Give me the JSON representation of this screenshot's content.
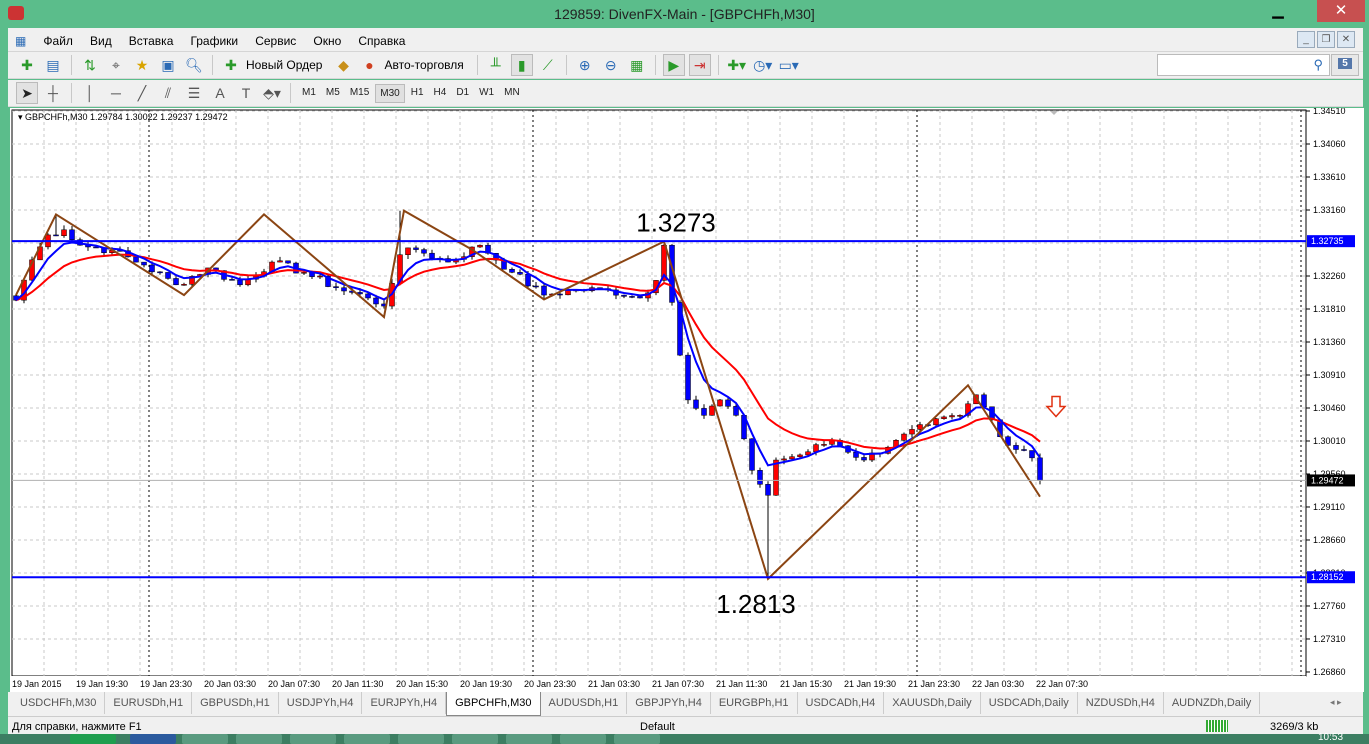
{
  "window": {
    "title": "129859: DivenFX-Main - [GBPCHFh,M30]",
    "min": "▁",
    "max": "☐",
    "close": "✕"
  },
  "menu": [
    "Файл",
    "Вид",
    "Вставка",
    "Графики",
    "Сервис",
    "Окно",
    "Справка"
  ],
  "toolbar": {
    "new_order": "Новый Ордер",
    "autotrading": "Авто-торговля",
    "timeframes": [
      "M1",
      "M5",
      "M15",
      "M30",
      "H1",
      "H4",
      "D1",
      "W1",
      "MN"
    ],
    "active_timeframe": "M30",
    "search_placeholder": "",
    "messages_count": "5"
  },
  "chart": {
    "info": "GBPCHFh,M30  1.29784 1.30022 1.29237 1.29472",
    "price_ticks": [
      "1.34510",
      "1.34060",
      "1.33610",
      "1.33160",
      "1.32260",
      "1.31810",
      "1.31360",
      "1.30910",
      "1.30460",
      "1.30010",
      "1.29560",
      "1.29110",
      "1.28660",
      "1.28210",
      "1.27760",
      "1.27310",
      "1.26860"
    ],
    "hlines": [
      {
        "price": 1.32735,
        "label": "1.32735",
        "color": "#0000ff"
      },
      {
        "price": 1.28152,
        "label": "1.28152",
        "color": "#0000ff"
      }
    ],
    "current_price": {
      "price": 1.29472,
      "label": "1.29472"
    },
    "annotations": [
      {
        "text": "1.3273",
        "bar": 83,
        "price": 1.3273,
        "pos": "above"
      },
      {
        "text": "1.2813",
        "bar": 93,
        "price": 1.2813,
        "pos": "below"
      }
    ],
    "time_labels": [
      "19 Jan 2015",
      "19 Jan 19:30",
      "19 Jan 23:30",
      "20 Jan 03:30",
      "20 Jan 07:30",
      "20 Jan 11:30",
      "20 Jan 15:30",
      "20 Jan 19:30",
      "20 Jan 23:30",
      "21 Jan 03:30",
      "21 Jan 07:30",
      "21 Jan 11:30",
      "21 Jan 15:30",
      "21 Jan 19:30",
      "21 Jan 23:30",
      "22 Jan 03:30",
      "22 Jan 07:30"
    ],
    "bull_color": "#ff0000",
    "bear_color": "#0000ff",
    "fast_ma_color": "#0000ff",
    "slow_ma_color": "#ff0000",
    "zigzag_color": "#8b4513",
    "close_keypoints": [
      [
        0,
        1.3193
      ],
      [
        2,
        1.3248
      ],
      [
        4,
        1.3282
      ],
      [
        6,
        1.3289
      ],
      [
        8,
        1.3268
      ],
      [
        12,
        1.3261
      ],
      [
        16,
        1.3241
      ],
      [
        20,
        1.3214
      ],
      [
        24,
        1.3237
      ],
      [
        28,
        1.3214
      ],
      [
        32,
        1.3245
      ],
      [
        36,
        1.3231
      ],
      [
        40,
        1.321
      ],
      [
        44,
        1.3196
      ],
      [
        46,
        1.3185
      ],
      [
        48,
        1.3255
      ],
      [
        50,
        1.3262
      ],
      [
        54,
        1.3245
      ],
      [
        58,
        1.3268
      ],
      [
        62,
        1.3231
      ],
      [
        66,
        1.32
      ],
      [
        70,
        1.3207
      ],
      [
        74,
        1.3207
      ],
      [
        78,
        1.3196
      ],
      [
        80,
        1.322
      ],
      [
        81,
        1.3268
      ],
      [
        82,
        1.319
      ],
      [
        84,
        1.3057
      ],
      [
        86,
        1.3036
      ],
      [
        88,
        1.3057
      ],
      [
        90,
        1.3036
      ],
      [
        92,
        1.2961
      ],
      [
        94,
        1.2927
      ],
      [
        95,
        1.2975
      ],
      [
        98,
        1.2982
      ],
      [
        102,
        1.3002
      ],
      [
        106,
        1.2975
      ],
      [
        110,
        1.3002
      ],
      [
        114,
        1.3023
      ],
      [
        118,
        1.3036
      ],
      [
        120,
        1.3064
      ],
      [
        122,
        1.303
      ],
      [
        124,
        1.2995
      ],
      [
        126,
        1.2988
      ],
      [
        127,
        1.2978
      ],
      [
        128,
        1.2947
      ]
    ],
    "wick_overrides": [
      [
        81,
        1.3273,
        null
      ],
      [
        94,
        null,
        1.2813
      ],
      [
        48,
        1.3315,
        null
      ],
      [
        5,
        1.331,
        null
      ]
    ],
    "zigzag": [
      [
        0,
        1.32
      ],
      [
        5,
        1.331
      ],
      [
        21,
        1.32
      ],
      [
        31,
        1.331
      ],
      [
        46,
        1.317
      ],
      [
        48.5,
        1.3315
      ],
      [
        57,
        1.3262
      ],
      [
        66,
        1.3194
      ],
      [
        81,
        1.3273
      ],
      [
        94,
        1.2813
      ],
      [
        119,
        1.3077
      ],
      [
        128,
        1.2925
      ]
    ],
    "signal_arrow": {
      "bar": 130,
      "price": 1.3048,
      "direction": "down"
    }
  },
  "tabs": [
    "USDCHFh,M30",
    "EURUSDh,H1",
    "GBPUSDh,H1",
    "USDJPYh,H4",
    "EURJPYh,H4",
    "GBPCHFh,M30",
    "AUDUSDh,H1",
    "GBPJPYh,H4",
    "EURGBPh,H1",
    "USDCADh,H4",
    "XAUUSDh,Daily",
    "USDCADh,Daily",
    "NZDUSDh,H4",
    "AUDNZDh,Daily"
  ],
  "active_tab": "GBPCHFh,M30",
  "status": {
    "help": "Для справки, нажмите F1",
    "profile": "Default",
    "traffic": "3269/3 kb"
  },
  "taskbar": {
    "clock": "10:53"
  }
}
